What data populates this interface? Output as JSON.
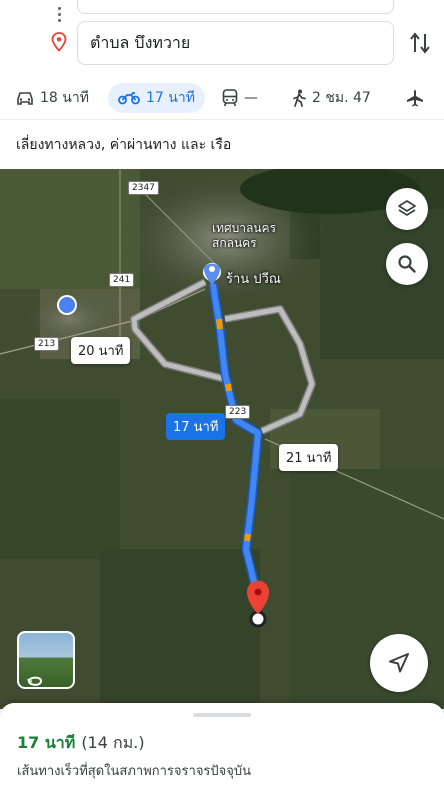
{
  "destination": {
    "value": "ตำบล บึงทวาย"
  },
  "modes": [
    {
      "icon": "car-icon",
      "label": "18 นาที"
    },
    {
      "icon": "motorcycle-icon",
      "label": "17 นาที"
    },
    {
      "icon": "transit-icon",
      "label": "—"
    },
    {
      "icon": "walk-icon",
      "label": "2 ชม. 47"
    },
    {
      "icon": "flight-icon",
      "label": ""
    }
  ],
  "avoid_text": "เลี่ยงทางหลวง, ค่าผ่านทาง และ เรือ",
  "map": {
    "route_labels": {
      "alt_left": "20 นาที",
      "main": "17 นาที",
      "alt_right": "21 นาที"
    },
    "road_shields": [
      "2347",
      "241",
      "213",
      "223"
    ],
    "places": {
      "town_line1": "เทศบาลนคร",
      "town_line2": "สกลนคร",
      "shop": "ร้าน ปวีณ"
    },
    "colors": {
      "route_main": "#4285f4",
      "route_alt": "#bdbdbd",
      "destination_pin": "#ea4335"
    }
  },
  "sheet": {
    "time": "17 นาที",
    "distance": "(14 กม.)",
    "description": "เส้นทางเร็วที่สุดในสภาพการจราจรปัจจุบัน"
  }
}
